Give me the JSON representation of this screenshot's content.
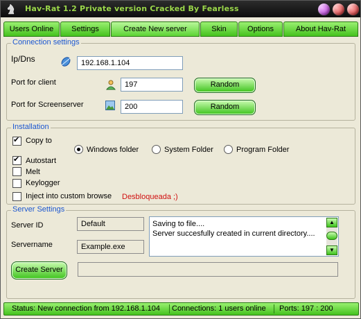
{
  "window": {
    "title": "Hav-Rat 1.2 Private version Cracked By Fearless"
  },
  "tabs": [
    "Users Online",
    "Settings",
    "Create New server",
    "Skin",
    "Options",
    "About Hav-Rat"
  ],
  "connection": {
    "group_title": "Connection settings",
    "ip_label": "Ip/Dns",
    "ip_value": "192.168.1.104",
    "port_client_label": "Port for client",
    "port_client_value": "197",
    "port_screen_label": "Port for Screenserver",
    "port_screen_value": "200",
    "random_label": "Random"
  },
  "installation": {
    "group_title": "Installation",
    "copy_to": {
      "label": "Copy to",
      "checked": true
    },
    "autostart": {
      "label": "Autostart",
      "checked": true
    },
    "melt": {
      "label": "Melt",
      "checked": false
    },
    "keylogger": {
      "label": "Keylogger",
      "checked": false
    },
    "inject": {
      "label": "Inject into custom browse",
      "checked": false
    },
    "unlocked_text": "Desbloqueada ;)",
    "folders": [
      "Windows folder",
      "System Folder",
      "Program Folder"
    ],
    "selected_folder": "Windows folder"
  },
  "server": {
    "group_title": "Server Settings",
    "id_label": "Server ID",
    "id_value": "Default",
    "name_label": "Servername",
    "name_value": "Example.exe",
    "log_lines": [
      "Saving to file....",
      "Server succesfully created in current directory...."
    ],
    "create_label": "Create Server",
    "progress_percent": 0
  },
  "status": {
    "connection": "Status: New connection from 192.168.1.104",
    "users": "Connections: 1 users online",
    "ports": "Ports: 197 : 200"
  },
  "colors": {
    "accent_green": "#45c21e",
    "title_green": "#9bd84a",
    "group_blue": "#1b56d0",
    "status_red": "#d01010"
  }
}
